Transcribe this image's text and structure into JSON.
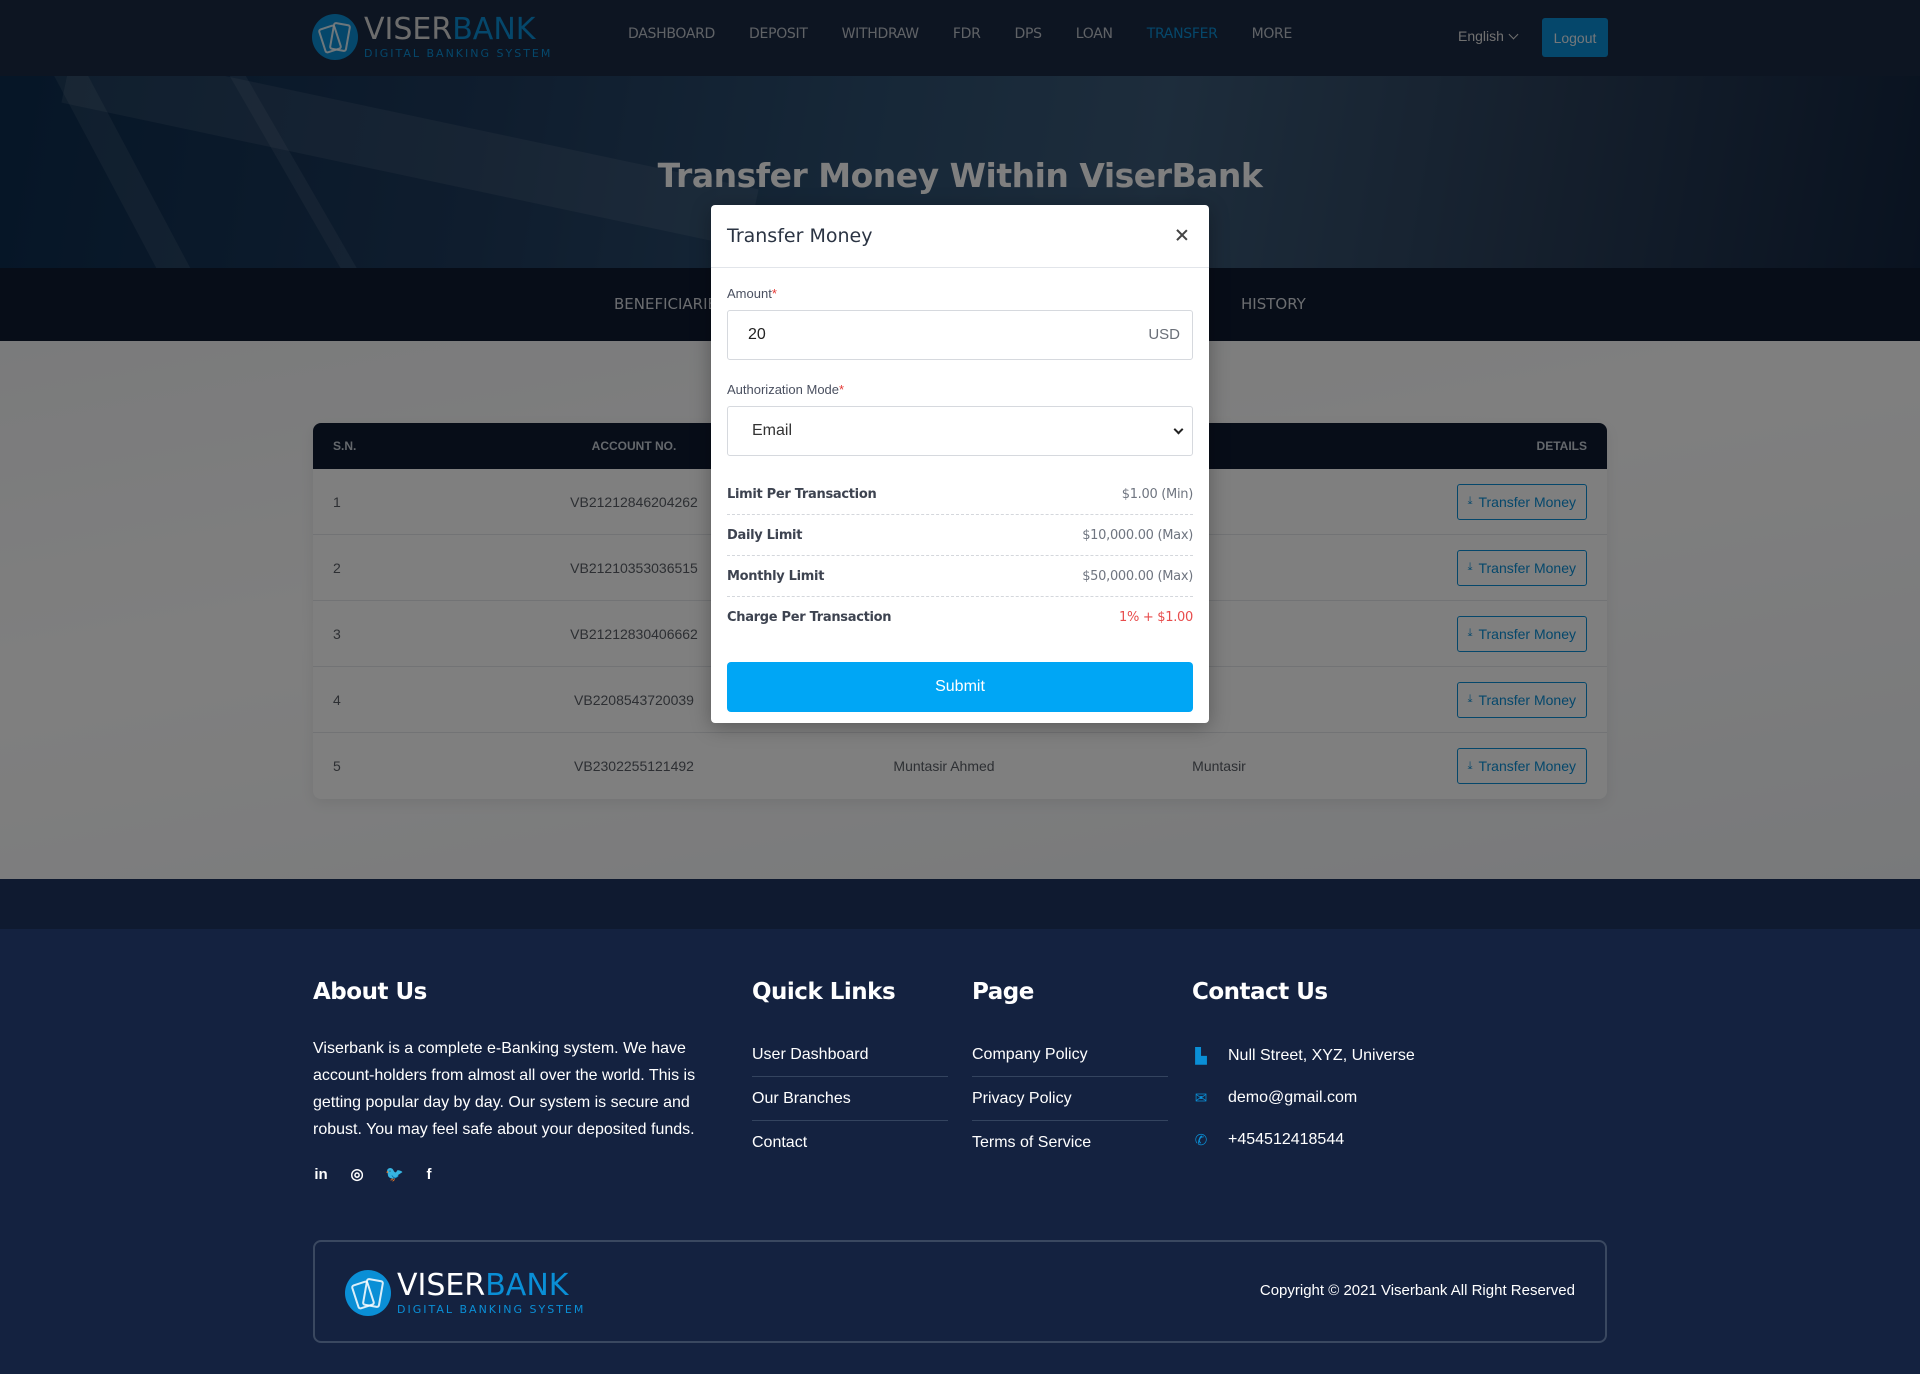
{
  "header": {
    "logo": {
      "brand_white": "VISER",
      "brand_blue": "BANK",
      "tagline": "DIGITAL BANKING SYSTEM"
    },
    "nav": [
      {
        "label": "DASHBOARD",
        "active": false
      },
      {
        "label": "DEPOSIT",
        "active": false
      },
      {
        "label": "WITHDRAW",
        "active": false
      },
      {
        "label": "FDR",
        "active": false
      },
      {
        "label": "DPS",
        "active": false
      },
      {
        "label": "LOAN",
        "active": false
      },
      {
        "label": "TRANSFER",
        "active": true
      },
      {
        "label": "MORE",
        "active": false
      }
    ],
    "language": "English",
    "logout_label": "Logout"
  },
  "hero": {
    "title": "Transfer Money Within ViserBank"
  },
  "subnav": {
    "left_label": "BENEFICIARIES",
    "right_label": "HISTORY"
  },
  "table": {
    "headers": {
      "sn": "S.N.",
      "account": "ACCOUNT NO.",
      "details": "DETAILS"
    },
    "rows": [
      {
        "sn": "1",
        "account": "VB21212846204262",
        "name": "",
        "short": "",
        "action": "Transfer Money"
      },
      {
        "sn": "2",
        "account": "VB21210353036515",
        "name": "",
        "short": "",
        "action": "Transfer Money"
      },
      {
        "sn": "3",
        "account": "VB21212830406662",
        "name": "",
        "short": "",
        "action": "Transfer Money"
      },
      {
        "sn": "4",
        "account": "VB2208543720039",
        "name": "",
        "short": "",
        "action": "Transfer Money"
      },
      {
        "sn": "5",
        "account": "VB2302255121492",
        "name": "Muntasir Ahmed",
        "short": "Muntasir",
        "action": "Transfer Money"
      }
    ]
  },
  "modal": {
    "title": "Transfer Money",
    "amount": {
      "label": "Amount",
      "required_mark": "*",
      "value": "20",
      "unit": "USD"
    },
    "auth": {
      "label": "Authorization Mode",
      "required_mark": "*",
      "selected": "Email"
    },
    "limits": [
      {
        "key": "Limit Per Transaction",
        "value": "$1.00 (Min)",
        "highlight": false
      },
      {
        "key": "Daily Limit",
        "value": "$10,000.00 (Max)",
        "highlight": false
      },
      {
        "key": "Monthly Limit",
        "value": "$50,000.00 (Max)",
        "highlight": false
      },
      {
        "key": "Charge Per Transaction",
        "value": "1% + $1.00",
        "highlight": true
      }
    ],
    "submit_label": "Submit"
  },
  "footer": {
    "about": {
      "title": "About Us",
      "text": "Viserbank is a complete e-Banking system. We have account-holders from almost all over the world. This is getting popular day by day. Our system is secure and robust. You may feel safe about your deposited funds.",
      "social": [
        "in",
        "◎",
        "🐦",
        "f"
      ]
    },
    "quick_links": {
      "title": "Quick Links",
      "items": [
        "User Dashboard",
        "Our Branches",
        "Contact"
      ]
    },
    "page": {
      "title": "Page",
      "items": [
        "Company Policy",
        "Privacy Policy",
        "Terms of Service"
      ]
    },
    "contact": {
      "title": "Contact Us",
      "address": "Null Street, XYZ, Universe",
      "email": "demo@gmail.com",
      "phone": "+454512418544"
    },
    "copyright": "Copyright © 2021 Viserbank All Right Reserved"
  },
  "colors": {
    "accent": "#0a8fd6",
    "submit": "#00a6f5",
    "danger": "#e84c4c",
    "navy": "#0f1a30",
    "footer": "#142240"
  }
}
